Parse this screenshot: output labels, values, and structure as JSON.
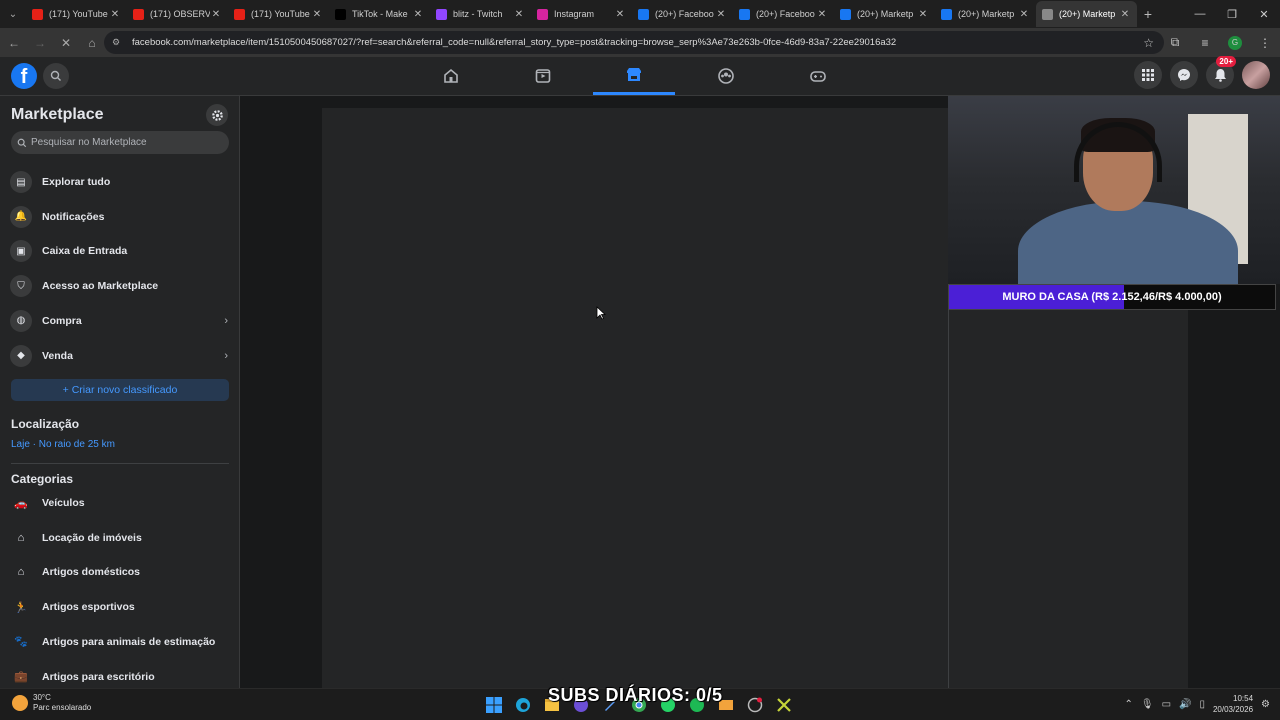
{
  "browser": {
    "tabs": [
      {
        "label": "(171) YouTube",
        "icon": "youtube-icon",
        "color": "#e62117"
      },
      {
        "label": "(171) OBSERVA",
        "icon": "youtube-icon",
        "color": "#e62117"
      },
      {
        "label": "(171) YouTube",
        "icon": "youtube-icon",
        "color": "#e62117"
      },
      {
        "label": "TikTok - Make",
        "icon": "tiktok-icon",
        "color": "#000000"
      },
      {
        "label": "blitz - Twitch",
        "icon": "twitch-icon",
        "color": "#9146ff"
      },
      {
        "label": "Instagram",
        "icon": "instagram-icon",
        "color": "#d6249f"
      },
      {
        "label": "(20+) Faceboo",
        "icon": "facebook-icon",
        "color": "#1877f2"
      },
      {
        "label": "(20+) Faceboo",
        "icon": "facebook-icon",
        "color": "#1877f2"
      },
      {
        "label": "(20+) Marketp",
        "icon": "facebook-icon",
        "color": "#1877f2"
      },
      {
        "label": "(20+) Marketp",
        "icon": "facebook-icon",
        "color": "#1877f2"
      },
      {
        "label": "(20+) Marketp",
        "icon": "loading-icon",
        "color": "#888888"
      }
    ],
    "url": "facebook.com/marketplace/item/1510500450687027/?ref=search&referral_code=null&referral_story_type=post&tracking=browse_serp%3Ae73e263b-0fce-46d9-83a7-22ee29016a32",
    "profile_initial": "G"
  },
  "header": {
    "notification_badge": "20+",
    "accent": "#2d88ff"
  },
  "sidebar": {
    "title": "Marketplace",
    "search_placeholder": "Pesquisar no Marketplace",
    "items": [
      {
        "label": "Explorar tudo",
        "icon": "storefront-icon"
      },
      {
        "label": "Notificações",
        "icon": "bell-icon"
      },
      {
        "label": "Caixa de Entrada",
        "icon": "inbox-icon"
      },
      {
        "label": "Acesso ao Marketplace",
        "icon": "shield-icon"
      },
      {
        "label": "Compra",
        "icon": "shopping-bag-icon"
      },
      {
        "label": "Venda",
        "icon": "tag-icon"
      }
    ],
    "create_button": "+ Criar novo classificado",
    "location_heading": "Localização",
    "location_value": "Laje · No raio de 25 km",
    "categories_heading": "Categorias",
    "categories": [
      {
        "label": "Veículos",
        "icon": "car-icon"
      },
      {
        "label": "Locação de imóveis",
        "icon": "house-key-icon"
      },
      {
        "label": "Artigos domésticos",
        "icon": "home-icon"
      },
      {
        "label": "Artigos esportivos",
        "icon": "running-icon"
      },
      {
        "label": "Artigos para animais de estimação",
        "icon": "paw-icon"
      },
      {
        "label": "Artigos para escritório",
        "icon": "briefcase-icon"
      }
    ]
  },
  "overlay": {
    "goal_text": "MURO DA CASA (R$ 2.152,46/R$ 4.000,00)",
    "goal_progress": 0.538,
    "goal_color": "#4b1fd6",
    "subs_text": "SUBS DIÁRIOS: 0/5"
  },
  "taskbar": {
    "temperature": "30°C",
    "weather": "Parc ensolarado",
    "time": "10:54",
    "date": "20/03/2026"
  }
}
